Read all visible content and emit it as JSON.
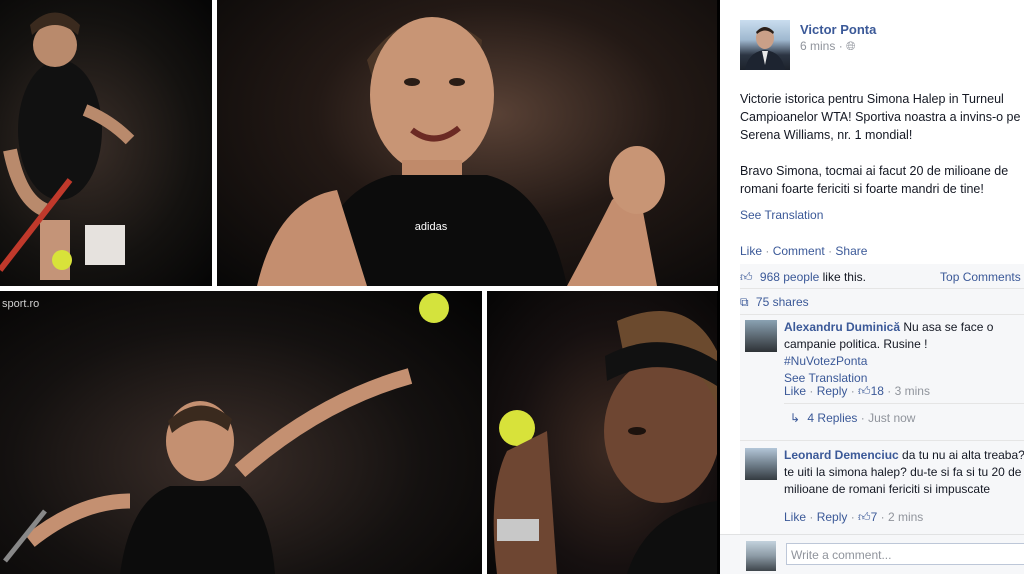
{
  "photos": {
    "watermark": "sport.ro"
  },
  "post": {
    "author": "Victor Ponta",
    "time": "6 mins",
    "privacy_icon": "globe-icon",
    "paragraph1": "Victorie istorica pentru Simona Halep in Turneul Campioanelor WTA! Sportiva noastra a invins-o pe Serena Williams, nr. 1 mondial!",
    "paragraph2": "Bravo Simona, tocmai ai facut 20 de milioane de romani foarte fericiti si foarte mandri de tine!",
    "see_translation": "See Translation",
    "actions": {
      "like": "Like",
      "comment": "Comment",
      "share": "Share",
      "sep": "·"
    }
  },
  "ufi": {
    "likes_people": "968 people",
    "likes_suffix": "like this.",
    "top_comments": "Top Comments",
    "shares": "75 shares"
  },
  "comments": [
    {
      "name": "Alexandru Duminică",
      "text": "Nu asa se face o campanie politica. Rusine !",
      "hashtag": "#NuVotezPonta",
      "see_translation": "See Translation",
      "like": "Like",
      "reply": "Reply",
      "likes": "18",
      "time": "3 mins",
      "replies": "4 Replies",
      "replies_time": "Just now"
    },
    {
      "name": "Leonard Demenciuc",
      "text": "da tu nu ai alta treaba? te uiti la simona halep? du-te si fa si tu 20 de milioane de romani fericiti si impuscate",
      "like": "Like",
      "reply": "Reply",
      "likes": "7",
      "time": "2 mins"
    }
  ],
  "composer": {
    "placeholder": "Write a comment..."
  }
}
